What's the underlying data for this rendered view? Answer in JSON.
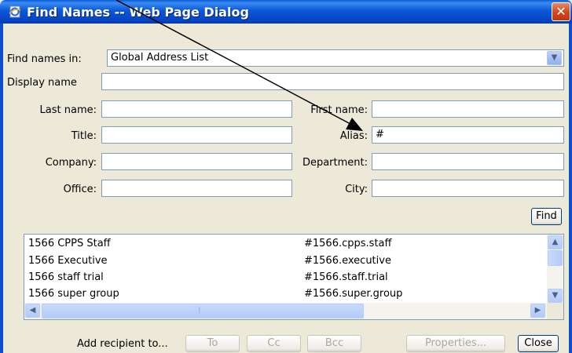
{
  "window": {
    "title": "Find Names -- Web Page Dialog",
    "close_glyph": "✕"
  },
  "form": {
    "find_in": {
      "label": "Find names in:",
      "value": "Global Address List"
    },
    "display_name": {
      "label": "Display name",
      "value": ""
    },
    "last_name": {
      "label": "Last name:",
      "value": ""
    },
    "first_name": {
      "label": "First name:",
      "value": ""
    },
    "title": {
      "label": "Title:",
      "value": ""
    },
    "alias": {
      "label": "Alias:",
      "value": "#"
    },
    "company": {
      "label": "Company:",
      "value": ""
    },
    "department": {
      "label": "Department:",
      "value": ""
    },
    "office": {
      "label": "Office:",
      "value": ""
    },
    "city": {
      "label": "City:",
      "value": ""
    },
    "find_button": "Find"
  },
  "results": [
    {
      "name": "1566 CPPS Staff",
      "alias": "#1566.cpps.staff"
    },
    {
      "name": "1566 Executive",
      "alias": "#1566.executive"
    },
    {
      "name": "1566 staff trial",
      "alias": "#1566.staff.trial"
    },
    {
      "name": "1566 super group",
      "alias": "#1566.super.group"
    }
  ],
  "footer": {
    "add_recipient_label": "Add recipient to...",
    "to": "To",
    "cc": "Cc",
    "bcc": "Bcc",
    "properties": "Properties...",
    "close": "Close"
  },
  "icons": {
    "scroll_up": "▲",
    "scroll_down": "▼",
    "scroll_left": "◀",
    "scroll_right": "▶",
    "grip": "⁞",
    "combo_arrow": "▼"
  }
}
